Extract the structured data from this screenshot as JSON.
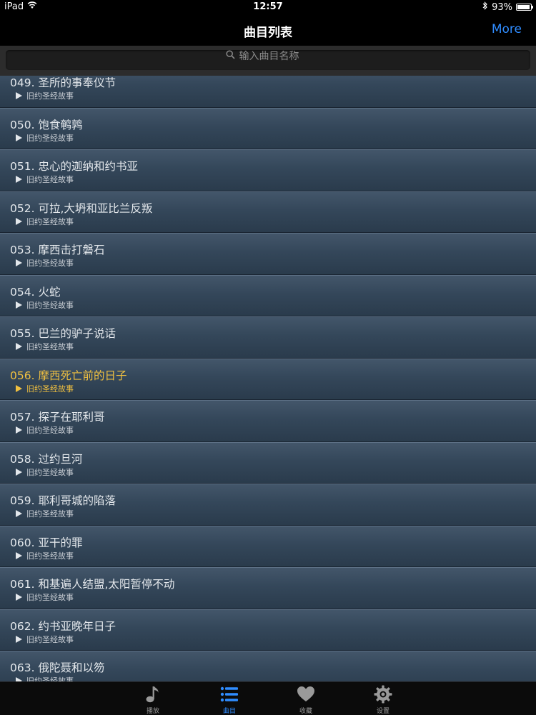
{
  "status_bar": {
    "device": "iPad",
    "time": "12:57",
    "battery": "93%",
    "battery_level": 0.93
  },
  "nav": {
    "title": "曲目列表",
    "more": "More"
  },
  "search": {
    "placeholder": "输入曲目名称"
  },
  "tracks": [
    {
      "title": "049. 圣所的事奉仪节",
      "subtitle": "旧约圣经故事"
    },
    {
      "title": "050. 饱食鹌鹑",
      "subtitle": "旧约圣经故事"
    },
    {
      "title": "051. 忠心的迦纳和约书亚",
      "subtitle": "旧约圣经故事"
    },
    {
      "title": "052. 可拉,大坍和亚比兰反叛",
      "subtitle": "旧约圣经故事"
    },
    {
      "title": "053. 摩西击打磐石",
      "subtitle": "旧约圣经故事"
    },
    {
      "title": "054. 火蛇",
      "subtitle": "旧约圣经故事"
    },
    {
      "title": "055. 巴兰的驴子说话",
      "subtitle": "旧约圣经故事"
    },
    {
      "title": "056. 摩西死亡前的日子",
      "subtitle": "旧约圣经故事",
      "active": true
    },
    {
      "title": "057. 探子在耶利哥",
      "subtitle": "旧约圣经故事"
    },
    {
      "title": "058. 过约旦河",
      "subtitle": "旧约圣经故事"
    },
    {
      "title": "059. 耶利哥城的陷落",
      "subtitle": "旧约圣经故事"
    },
    {
      "title": "060. 亚干的罪",
      "subtitle": "旧约圣经故事"
    },
    {
      "title": "061. 和基遍人结盟,太阳暂停不动",
      "subtitle": "旧约圣经故事"
    },
    {
      "title": "062. 约书亚晚年日子",
      "subtitle": "旧约圣经故事"
    },
    {
      "title": "063. 俄陀聂和以笏",
      "subtitle": "旧约圣经故事"
    }
  ],
  "tabs": [
    {
      "label": "播放",
      "icon": "music-note-icon"
    },
    {
      "label": "曲目",
      "icon": "list-icon",
      "active": true
    },
    {
      "label": "收藏",
      "icon": "heart-icon"
    },
    {
      "label": "设置",
      "icon": "gear-icon"
    }
  ],
  "colors": {
    "accent": "#2f8cff",
    "active_track": "#f0c040"
  }
}
